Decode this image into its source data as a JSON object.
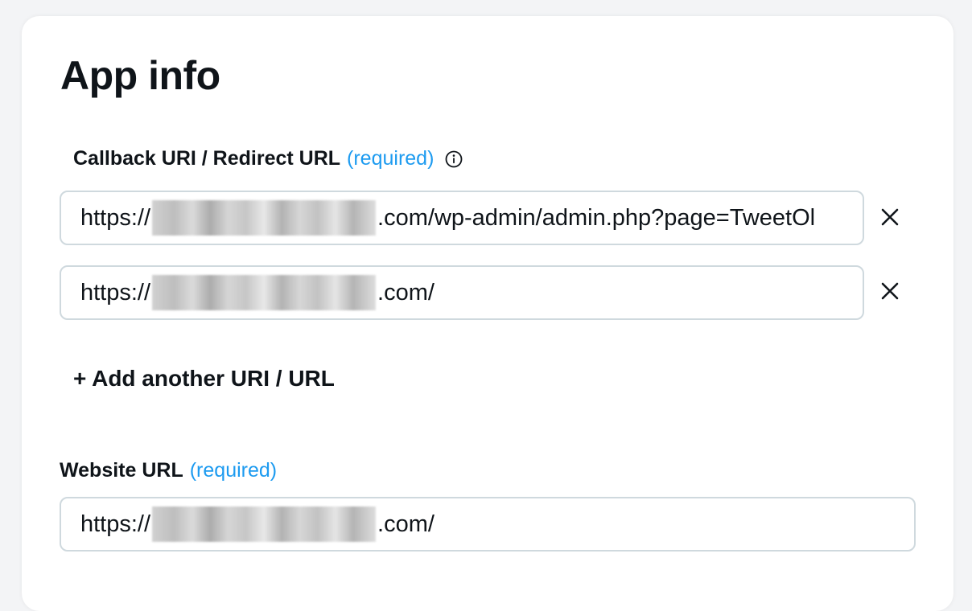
{
  "section": {
    "title": "App info"
  },
  "callback": {
    "label": "Callback URI / Redirect URL",
    "required_text": "(required)",
    "info_icon": "info-circle-icon",
    "urls": [
      {
        "prefix": "https://",
        "suffix": ".com/wp-admin/admin.php?page=TweetOl"
      },
      {
        "prefix": "https://",
        "suffix": ".com/"
      }
    ],
    "clear_icon": "close-icon",
    "add_label": "+ Add another URI / URL"
  },
  "website": {
    "label": "Website URL",
    "required_text": "(required)",
    "prefix": "https://",
    "suffix": ".com/"
  },
  "colors": {
    "accent": "#1d9bf0",
    "text": "#0f1419",
    "border": "#cfd9de"
  }
}
